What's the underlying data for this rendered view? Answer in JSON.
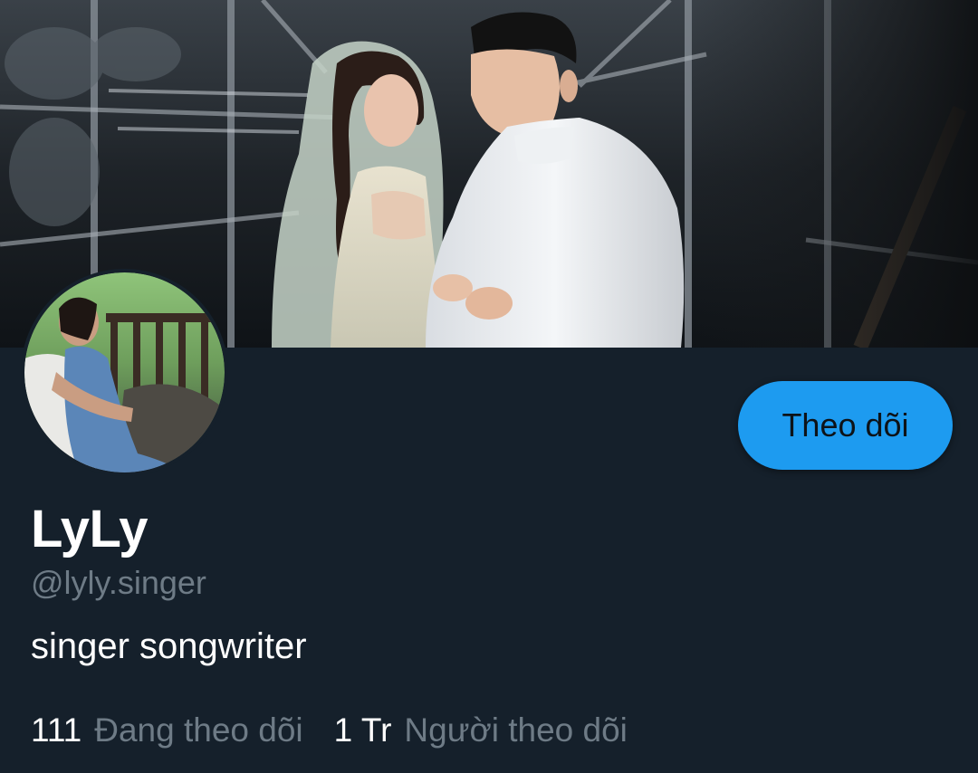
{
  "profile": {
    "display_name": "LyLy",
    "handle": "@lyly.singer",
    "bio": "singer songwriter",
    "follow_button_label": "Theo dõi"
  },
  "stats": {
    "following_count": "111",
    "following_label": "Đang theo dõi",
    "followers_count": "1 Tr",
    "followers_label": "Người theo dõi"
  },
  "colors": {
    "background": "#15202b",
    "accent": "#1d9bf0",
    "secondary_text": "#6e7b86",
    "primary_text": "#ffffff"
  },
  "images": {
    "banner": "couple-photo-banner",
    "avatar": "profile-photo"
  }
}
